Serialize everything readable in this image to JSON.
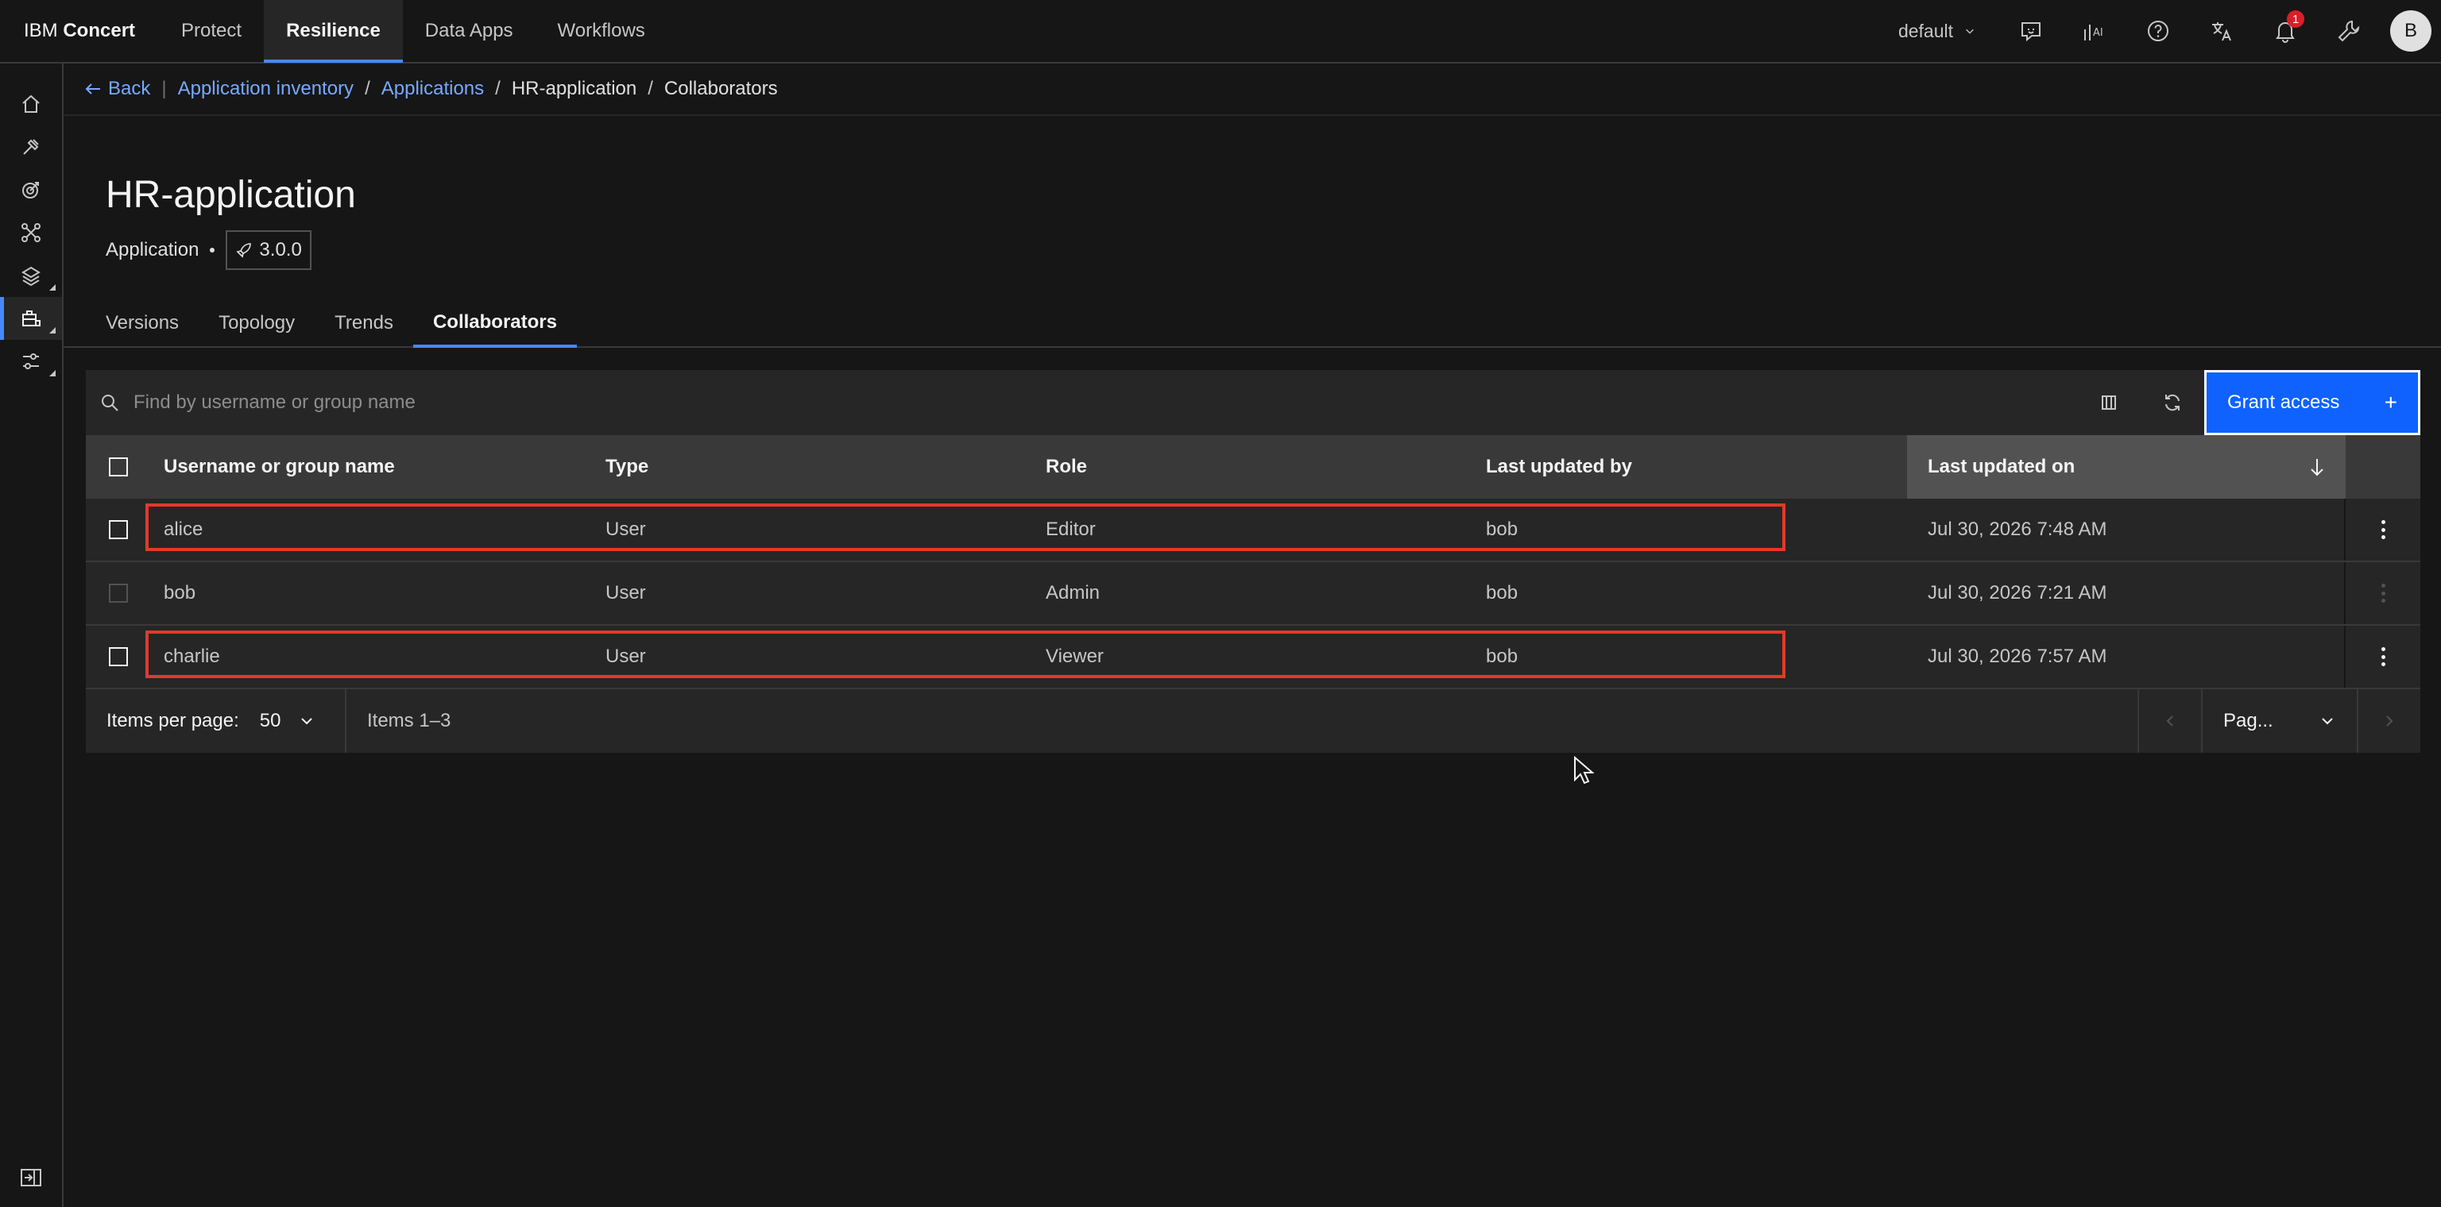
{
  "header": {
    "brand_prefix": "IBM",
    "brand_name": "Concert",
    "nav": [
      {
        "label": "Protect"
      },
      {
        "label": "Resilience"
      },
      {
        "label": "Data Apps"
      },
      {
        "label": "Workflows"
      }
    ],
    "tenant": "default",
    "notification_count": "1",
    "avatar_initial": "B",
    "accent_color": "#4589ff"
  },
  "sidebar": {
    "items": [
      {
        "icon": "home-icon"
      },
      {
        "icon": "tools-icon"
      },
      {
        "icon": "target-icon"
      },
      {
        "icon": "network-icon"
      },
      {
        "icon": "layers-icon"
      },
      {
        "icon": "app-inventory-icon"
      },
      {
        "icon": "settings-adjust-icon"
      }
    ],
    "bottom_icon": "side-panel-toggle-icon"
  },
  "breadcrumb": {
    "back": "Back",
    "items": [
      "Application inventory",
      "Applications",
      "HR-application",
      "Collaborators"
    ]
  },
  "page": {
    "title": "HR-application",
    "type": "Application",
    "version": "3.0.0"
  },
  "tabs": [
    {
      "label": "Versions"
    },
    {
      "label": "Topology"
    },
    {
      "label": "Trends"
    },
    {
      "label": "Collaborators"
    }
  ],
  "toolbar": {
    "search_placeholder": "Find by username or group name",
    "grant_label": "Grant access",
    "primary_color": "#0f62fe"
  },
  "table": {
    "columns": [
      "Username or group name",
      "Type",
      "Role",
      "Last updated by",
      "Last updated on"
    ],
    "rows": [
      {
        "name": "alice",
        "type": "User",
        "role": "Editor",
        "updated_by": "bob",
        "updated_on": "Jul 30, 2026 7:48 AM"
      },
      {
        "name": "bob",
        "type": "User",
        "role": "Admin",
        "updated_by": "bob",
        "updated_on": "Jul 30, 2026 7:21 AM"
      },
      {
        "name": "charlie",
        "type": "User",
        "role": "Viewer",
        "updated_by": "bob",
        "updated_on": "Jul 30, 2026 7:57 AM"
      }
    ],
    "highlight_color": "#e5382a"
  },
  "pagination": {
    "per_page_label": "Items per page:",
    "per_page_value": "50",
    "items_range": "Items 1–3",
    "page_select": "Pag..."
  }
}
